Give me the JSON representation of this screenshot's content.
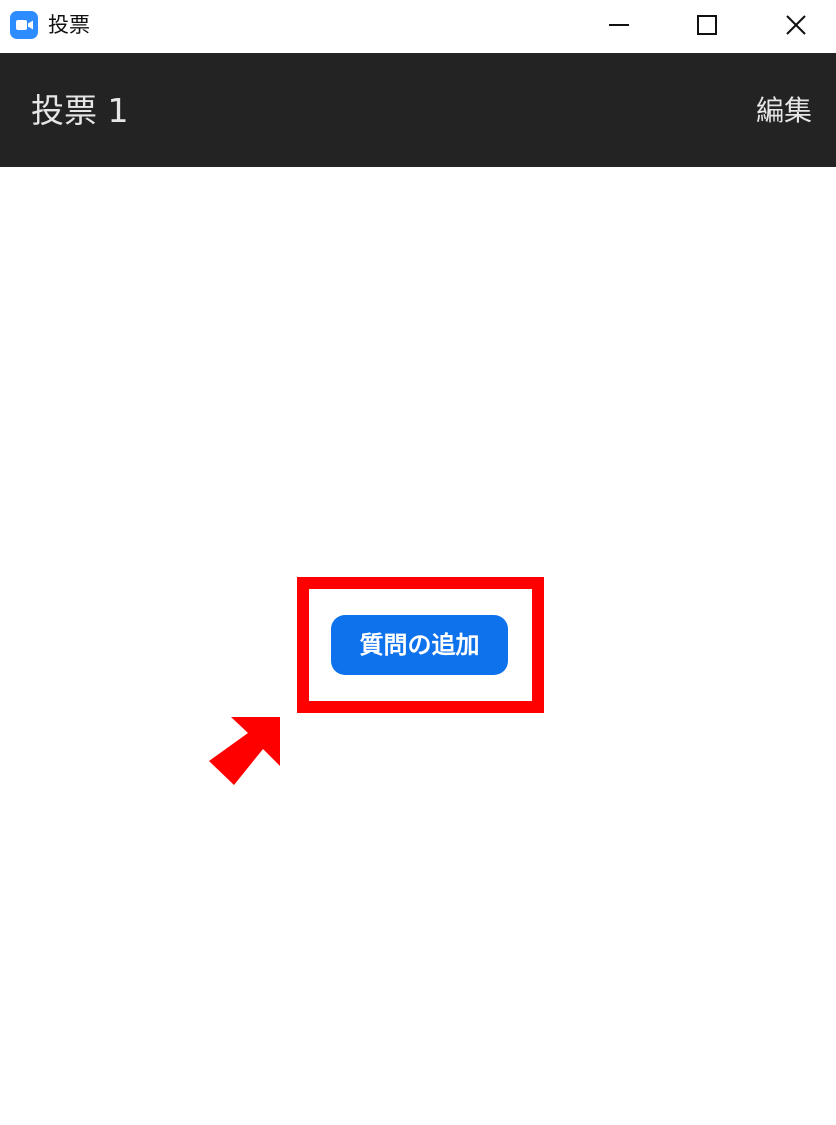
{
  "window": {
    "title": "投票",
    "icon": "zoom-camera-icon",
    "controls": [
      "minimize-icon",
      "maximize-icon",
      "close-icon"
    ]
  },
  "header": {
    "title": "投票 1",
    "edit_label": "編集",
    "background": "#232323"
  },
  "main": {
    "add_question_label": "質問の追加",
    "button_color": "#0e72ed",
    "highlight_color": "#ff0000",
    "annotation_arrow": "pointing-arrow-icon"
  }
}
